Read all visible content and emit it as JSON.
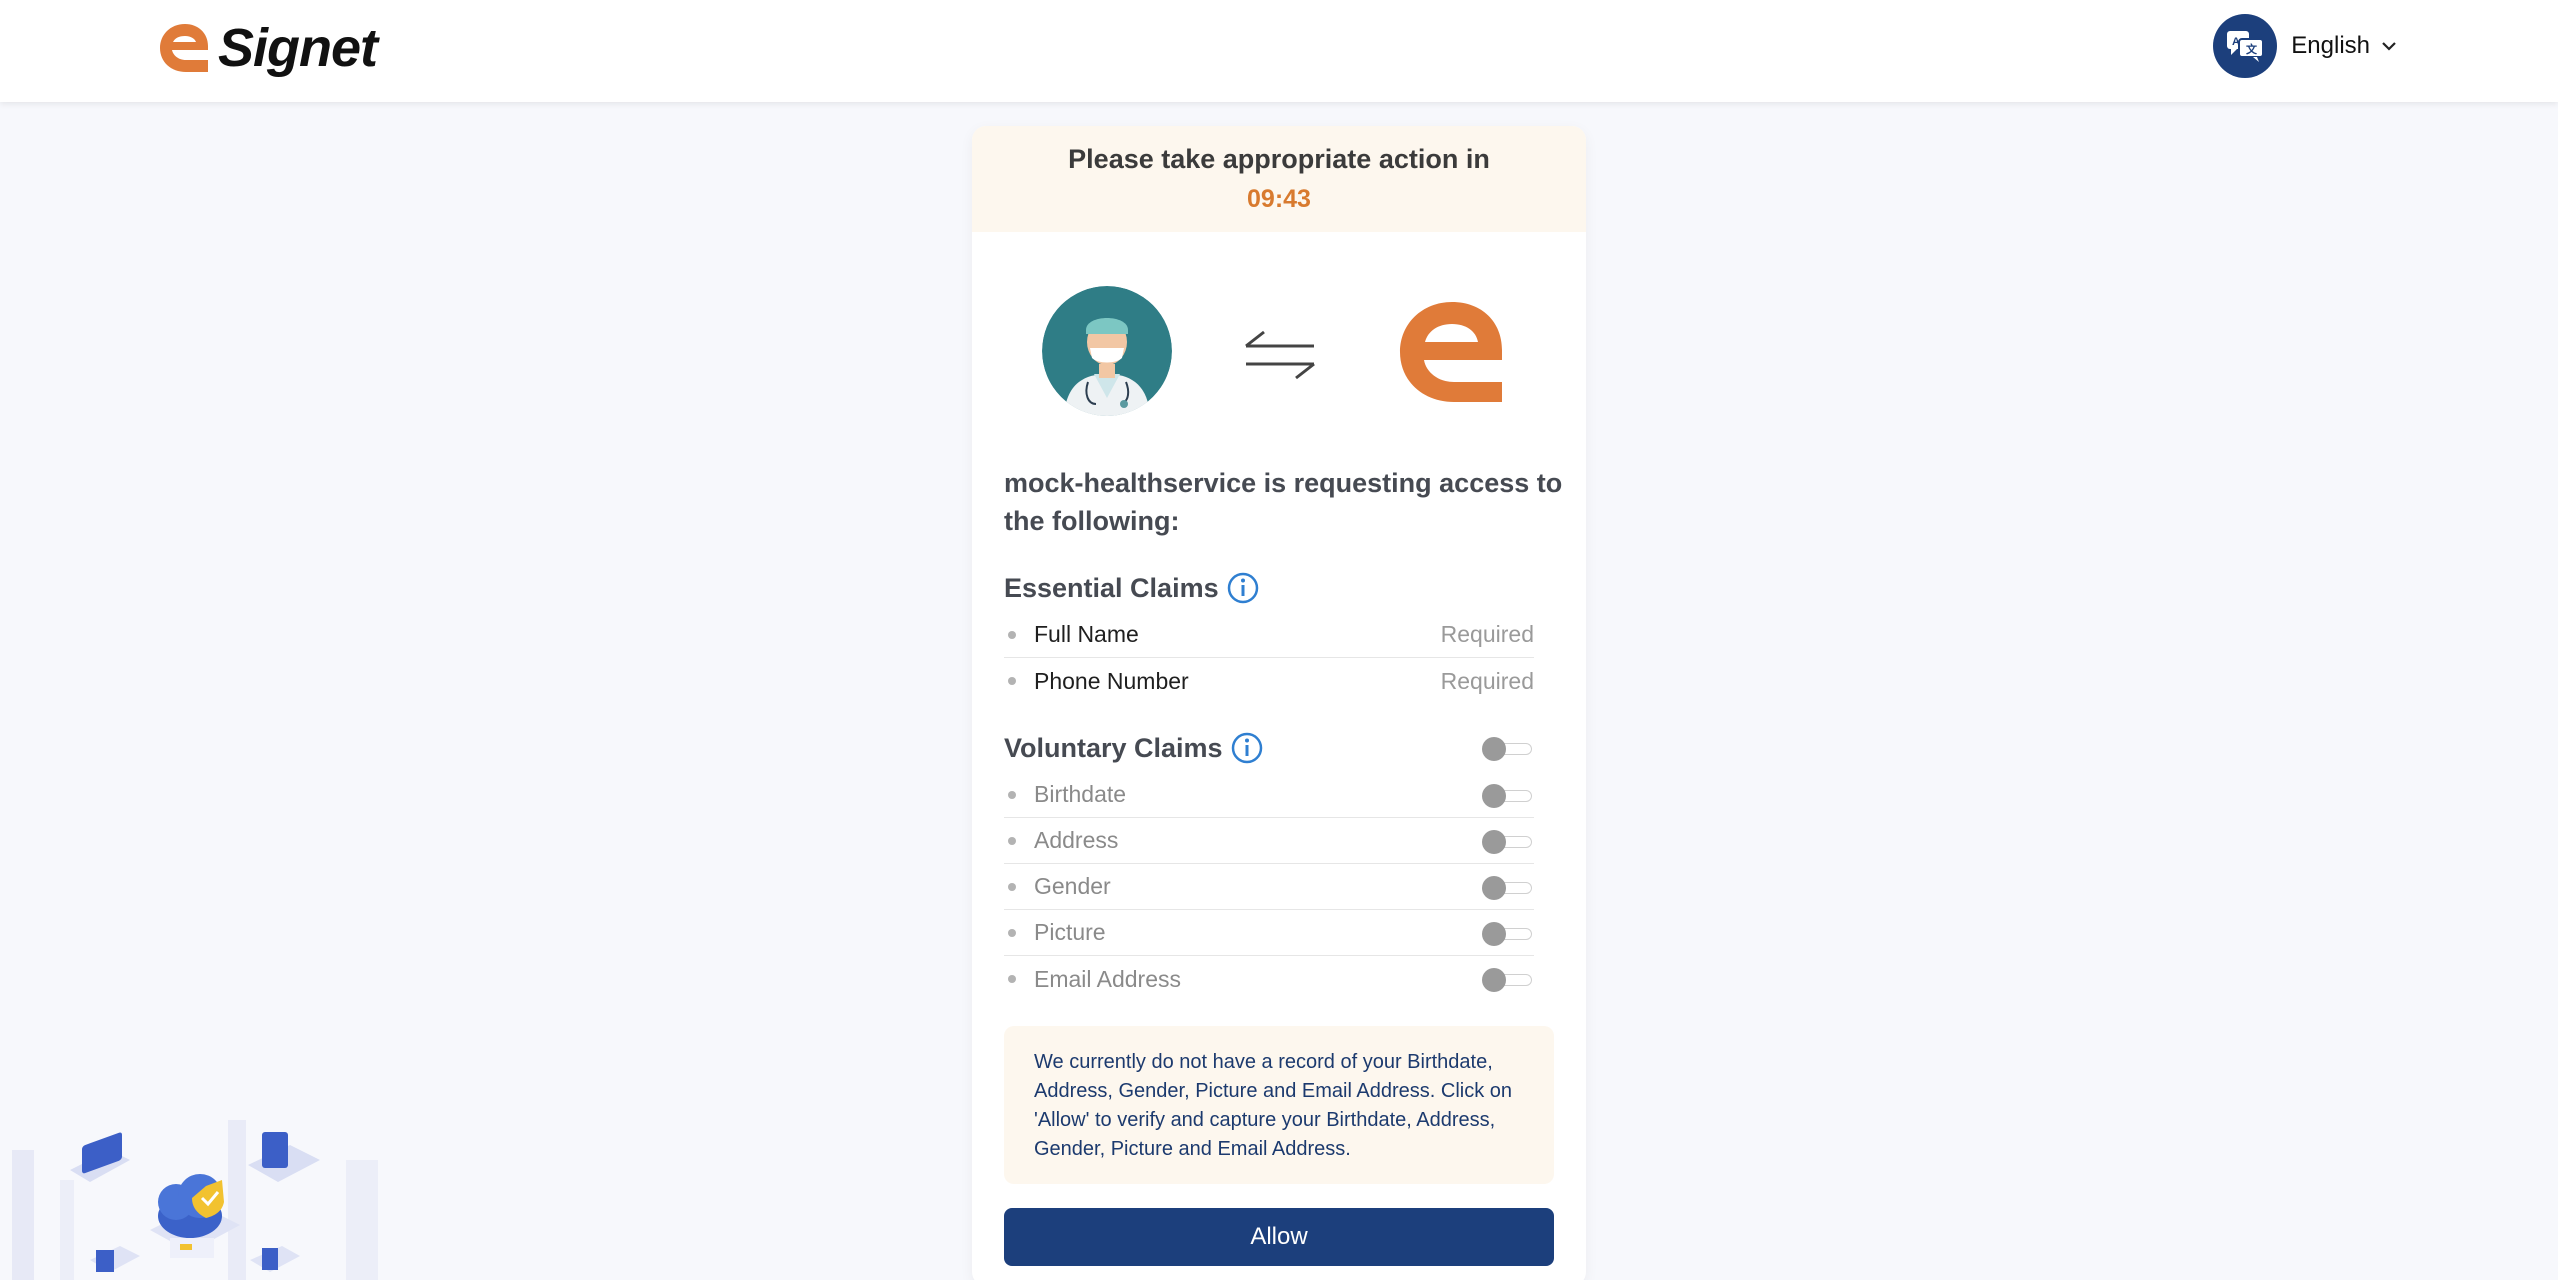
{
  "header": {
    "brand_name": "Signet",
    "language": "English",
    "icons": {
      "logo": "signet-logo-icon",
      "language": "language-icon",
      "chevron": "chevron-down-icon"
    }
  },
  "timer": {
    "title": "Please take appropriate action in",
    "value": "09:43"
  },
  "request": {
    "text": "mock-healthservice is requesting access to the following:"
  },
  "essential_claims": {
    "title": "Essential Claims",
    "items": [
      {
        "label": "Full Name",
        "status": "Required"
      },
      {
        "label": "Phone Number",
        "status": "Required"
      }
    ]
  },
  "voluntary_claims": {
    "title": "Voluntary Claims",
    "all_enabled": false,
    "items": [
      {
        "label": "Birthdate",
        "enabled": false
      },
      {
        "label": "Address",
        "enabled": false
      },
      {
        "label": "Gender",
        "enabled": false
      },
      {
        "label": "Picture",
        "enabled": false
      },
      {
        "label": "Email Address",
        "enabled": false
      }
    ]
  },
  "note": {
    "text": "We currently do not have a record of your Birthdate, Address, Gender, Picture and Email Address. Click on 'Allow' to verify and capture your Birthdate, Address, Gender, Picture and Email Address."
  },
  "actions": {
    "allow_label": "Allow"
  },
  "colors": {
    "primary": "#1c3f7c",
    "accent": "#e07b39",
    "timer": "#d87a2e",
    "note_bg": "#fdf7ee",
    "info": "#2f7fd1"
  }
}
